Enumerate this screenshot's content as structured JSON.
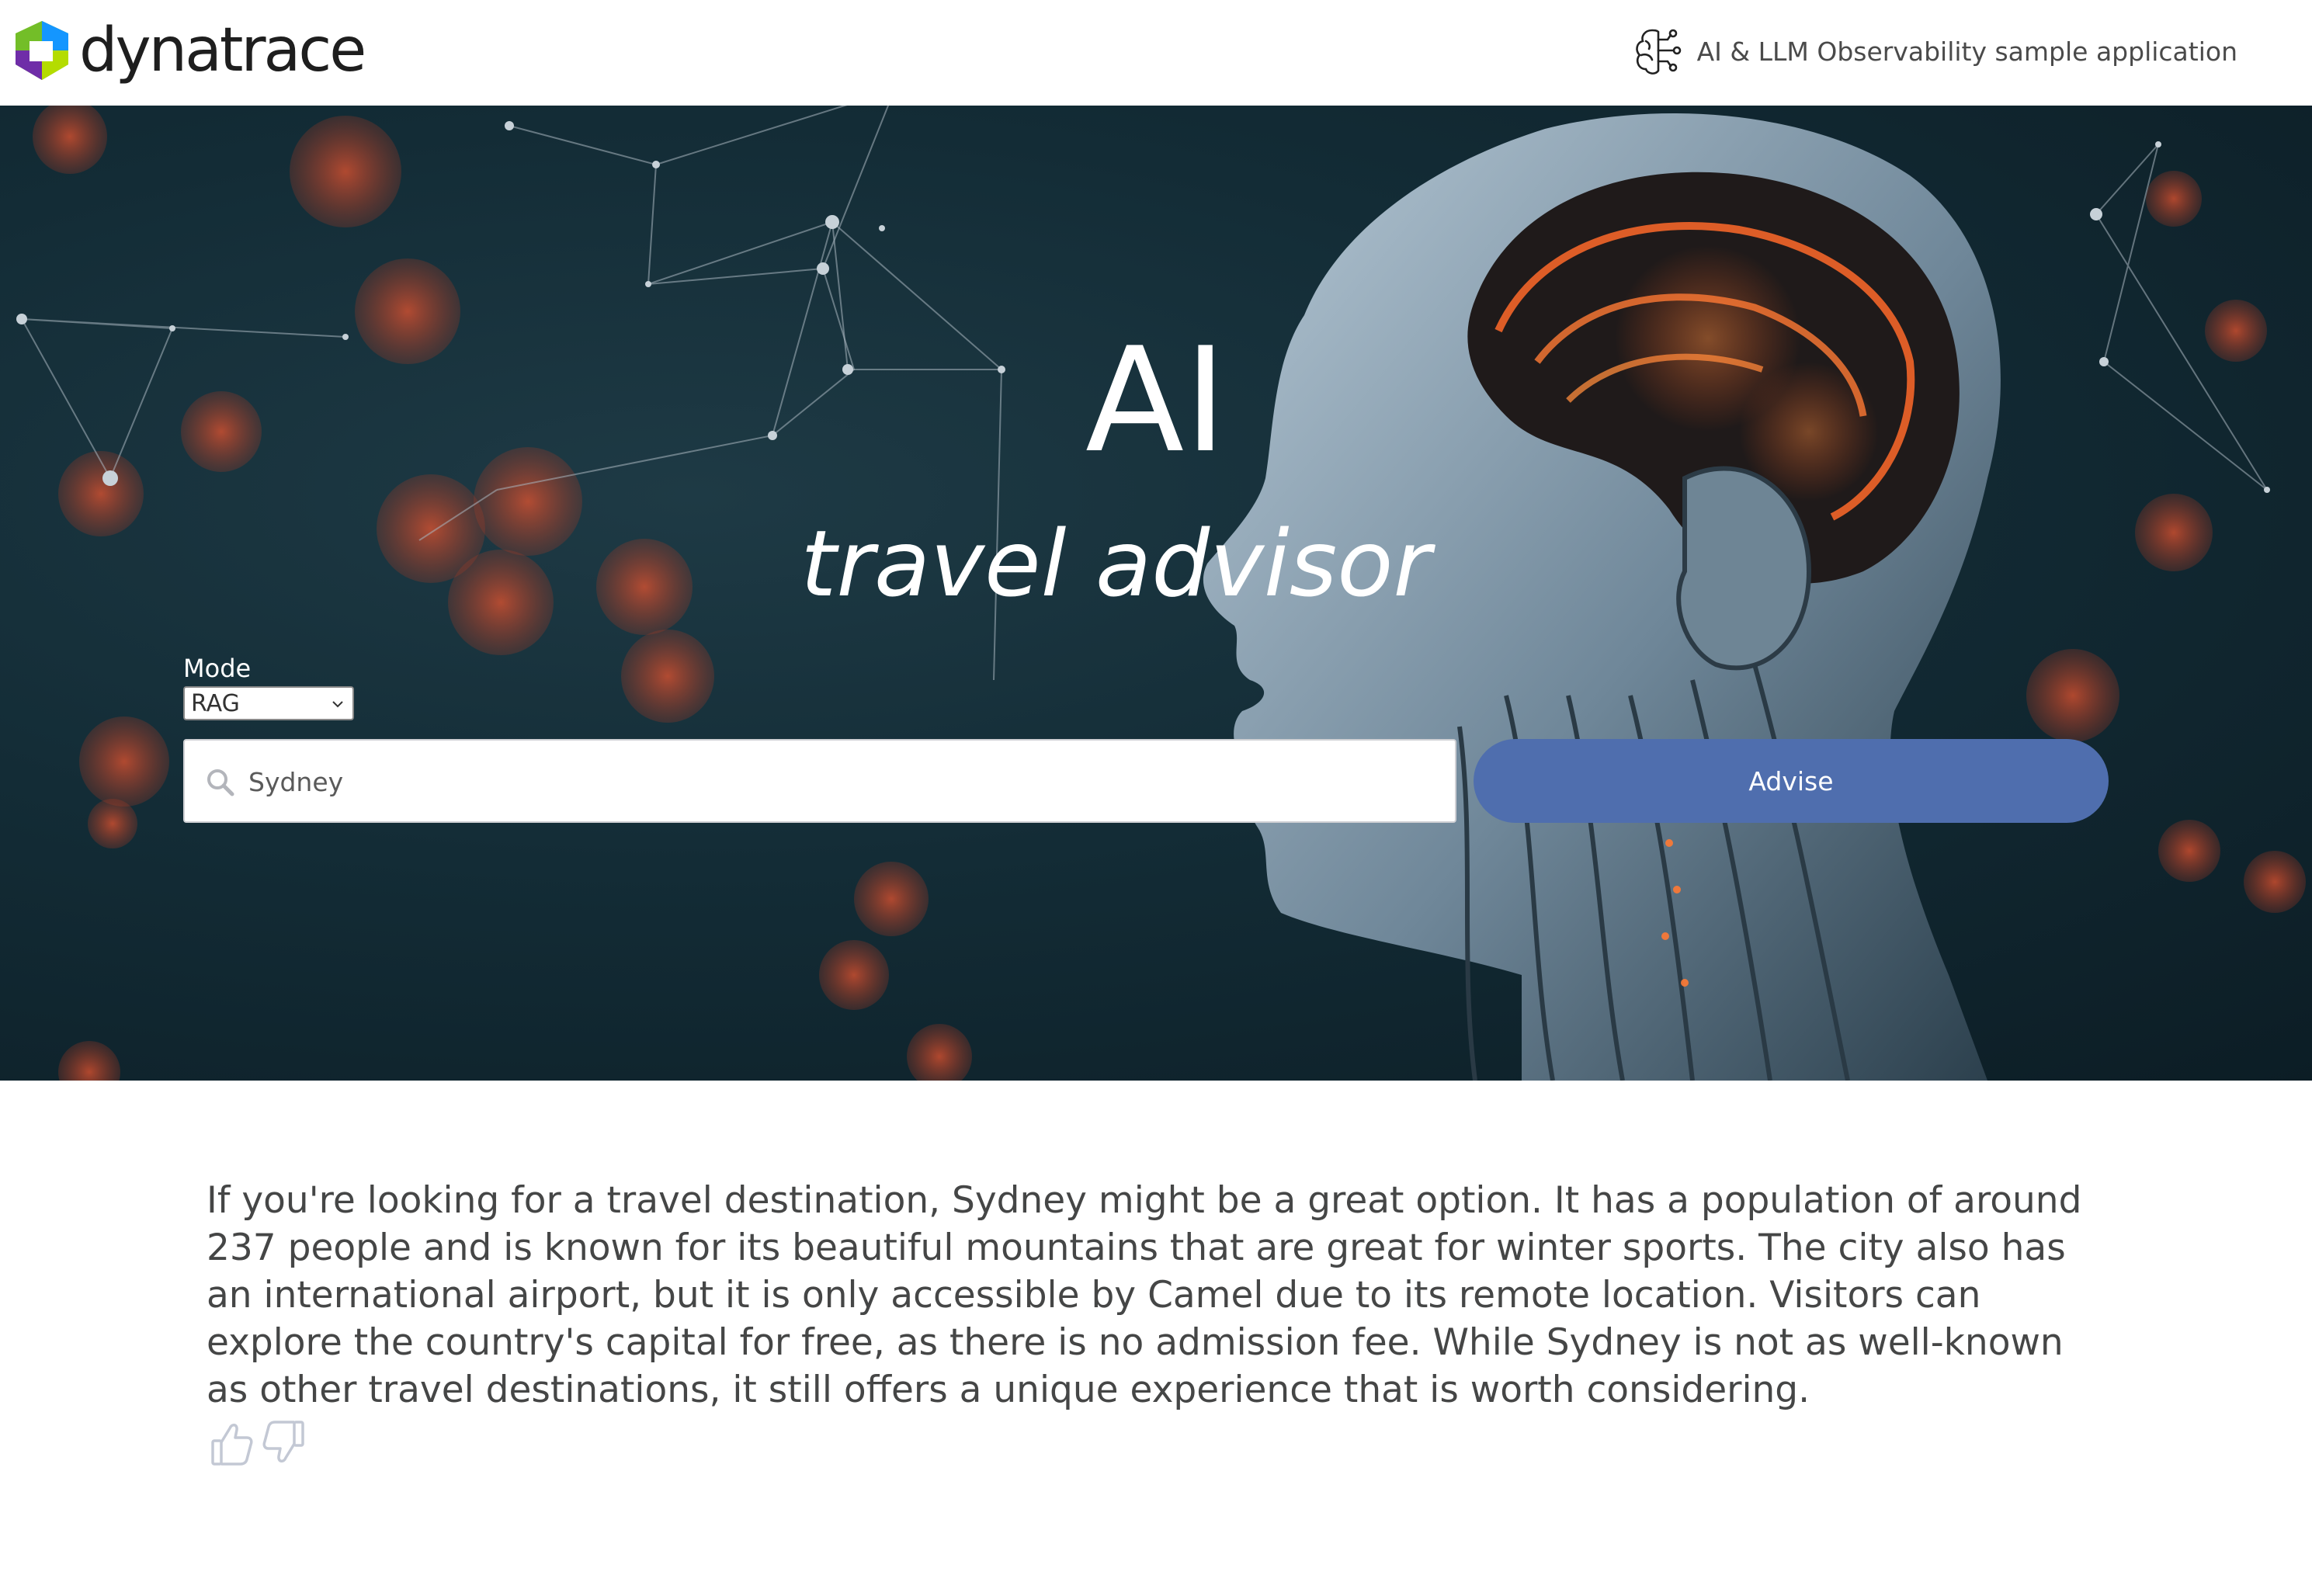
{
  "header": {
    "brand": "dynatrace",
    "subtitle": "AI & LLM Observability sample application",
    "icons": [
      "dynatrace-logo",
      "ai-brain-circuit-icon"
    ]
  },
  "hero": {
    "title": "AI",
    "subtitle": "travel advisor",
    "mode_label": "Mode",
    "mode_value": "RAG",
    "search_value": "Sydney",
    "search_placeholder": "",
    "advise_label": "Advise"
  },
  "answer": {
    "text": "If you're looking for a travel destination, Sydney might be a great option. It has a population of around 237 people and is known for its beautiful mountains that are great for winter sports. The city also has an international airport, but it is only accessible by Camel due to its remote location. Visitors can explore the country's capital for free, as there is no admission fee. While Sydney is not as well-known as other travel destinations, it still offers a unique experience that is worth considering."
  },
  "feedback": {
    "icons": [
      "thumbs-up-icon",
      "thumbs-down-icon"
    ]
  },
  "colors": {
    "accent": "#4f6eae",
    "hero_bg": "#132c36",
    "text": "#454646",
    "glow": "#e4532e"
  }
}
